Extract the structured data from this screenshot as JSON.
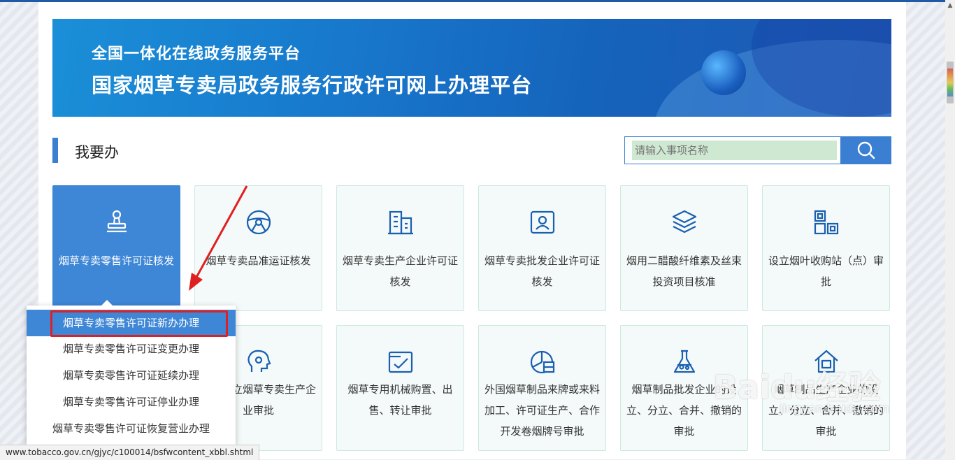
{
  "banner": {
    "subtitle": "全国一体化在线政务服务平台",
    "title": "国家烟草专卖局政务服务行政许可网上办理平台"
  },
  "section": {
    "title": "我要办"
  },
  "search": {
    "placeholder": "请输入事项名称"
  },
  "cards": [
    {
      "label": "烟草专卖零售许可证核发",
      "icon": "stamp-icon",
      "active": true
    },
    {
      "label": "烟草专卖品准运证核发",
      "icon": "steering-wheel-icon"
    },
    {
      "label": "烟草专卖生产企业许可证核发",
      "icon": "building-icon"
    },
    {
      "label": "烟草专卖批发企业许可证核发",
      "icon": "id-card-icon"
    },
    {
      "label": "烟用二醋酸纤维素及丝束投资项目核准",
      "icon": "layers-icon"
    },
    {
      "label": "设立烟叶收购站（点）审批",
      "icon": "blocks-icon"
    },
    {
      "label": "投资设立烟草专卖生产企业审批",
      "icon": "head-gear-icon"
    },
    {
      "label": "烟草专用机械购置、出售、转让审批",
      "icon": "check-screen-icon"
    },
    {
      "label": "外国烟草制品来牌或来料加工、许可证生产、合作开发卷烟牌号审批",
      "icon": "pie-chart-icon"
    },
    {
      "label": "烟草制品批发企业的设立、分立、合并、撤销的审批",
      "icon": "flask-icon"
    },
    {
      "label": "烟草制品生产企业的设立、分立、合并、撤销的审批",
      "icon": "house-cart-icon"
    }
  ],
  "dropdown": {
    "items": [
      "烟草专卖零售许可证新办办理",
      "烟草专卖零售许可证变更办理",
      "烟草专卖零售许可证延续办理",
      "烟草专卖零售许可证停业办理",
      "烟草专卖零售许可证恢复营业办理"
    ],
    "highlighted_index": 0
  },
  "status_bar": {
    "url": "www.tobacco.gov.cn/gjyc/c100014/bsfwcontent_xbbl.shtml"
  },
  "watermark": {
    "logo": "Baidu经验",
    "url": "jingyan.baidu.com"
  },
  "colors": {
    "accent": "#3e86d6",
    "highlight_box": "#e02020",
    "card_bg": "#f4faf9"
  }
}
